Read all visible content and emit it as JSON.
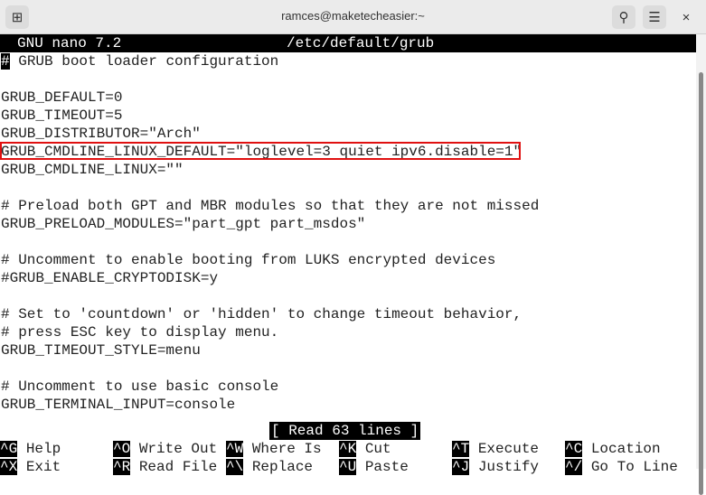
{
  "window": {
    "title": "ramces@maketecheasier:~",
    "icons": [
      "new-tab-icon",
      "search-icon",
      "menu-icon",
      "close-icon"
    ]
  },
  "nano": {
    "header_app": "GNU nano 7.2",
    "header_file": "/etc/default/grub",
    "lines": [
      "# GRUB boot loader configuration",
      "",
      "GRUB_DEFAULT=0",
      "GRUB_TIMEOUT=5",
      "GRUB_DISTRIBUTOR=\"Arch\"",
      "GRUB_CMDLINE_LINUX_DEFAULT=\"loglevel=3 quiet ipv6.disable=1\"",
      "GRUB_CMDLINE_LINUX=\"\"",
      "",
      "# Preload both GPT and MBR modules so that they are not missed",
      "GRUB_PRELOAD_MODULES=\"part_gpt part_msdos\"",
      "",
      "# Uncomment to enable booting from LUKS encrypted devices",
      "#GRUB_ENABLE_CRYPTODISK=y",
      "",
      "# Set to 'countdown' or 'hidden' to change timeout behavior,",
      "# press ESC key to display menu.",
      "GRUB_TIMEOUT_STYLE=menu",
      "",
      "# Uncomment to use basic console",
      "GRUB_TERMINAL_INPUT=console"
    ],
    "status": "[ Read 63 lines ]",
    "shortcuts": [
      [
        {
          "key": "^G",
          "label": "Help"
        },
        {
          "key": "^O",
          "label": "Write Out"
        },
        {
          "key": "^W",
          "label": "Where Is"
        },
        {
          "key": "^K",
          "label": "Cut"
        },
        {
          "key": "^T",
          "label": "Execute"
        },
        {
          "key": "^C",
          "label": "Location"
        }
      ],
      [
        {
          "key": "^X",
          "label": "Exit"
        },
        {
          "key": "^R",
          "label": "Read File"
        },
        {
          "key": "^\\",
          "label": "Replace"
        },
        {
          "key": "^U",
          "label": "Paste"
        },
        {
          "key": "^J",
          "label": "Justify"
        },
        {
          "key": "^/",
          "label": "Go To Line"
        }
      ]
    ]
  },
  "highlight_color": "#e01010"
}
